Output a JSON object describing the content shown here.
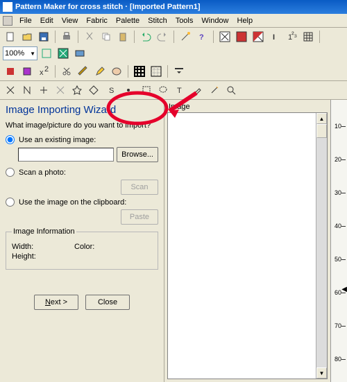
{
  "titlebar": {
    "text": "Pattern Maker for cross stitch · [Imported Pattern1]"
  },
  "menu": {
    "items": [
      "File",
      "Edit",
      "View",
      "Fabric",
      "Palette",
      "Stitch",
      "Tools",
      "Window",
      "Help"
    ]
  },
  "toolbar1": {
    "zoom": "100%"
  },
  "wizard": {
    "title": "Image Importing Wizard",
    "prompt": "What image/picture do you want to import?",
    "opt_existing": "Use an existing image:",
    "browse": "Browse...",
    "opt_scan": "Scan a photo:",
    "scan": "Scan",
    "opt_clipboard": "Use the image on the clipboard:",
    "paste": "Paste"
  },
  "info": {
    "legend": "Image Information",
    "width": "Width:",
    "color": "Color:",
    "height": "Height:"
  },
  "nav": {
    "next": "Next >",
    "close": "Close"
  },
  "preview": {
    "label": "Image"
  },
  "ruler": {
    "marks": [
      "10",
      "20",
      "30",
      "40",
      "50",
      "60",
      "70",
      "80"
    ]
  }
}
